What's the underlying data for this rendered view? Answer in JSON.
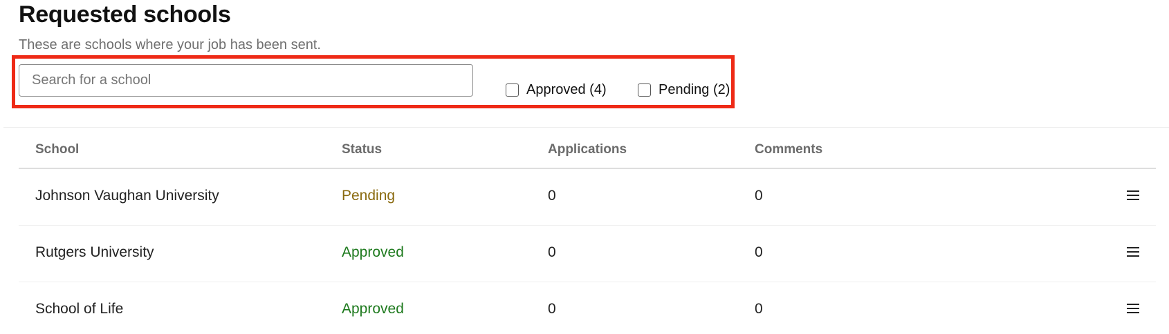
{
  "header": {
    "title": "Requested schools",
    "subtitle": "These are schools where your job has been sent."
  },
  "search": {
    "placeholder": "Search for a school",
    "value": ""
  },
  "filters": [
    {
      "label": "Approved (4)",
      "checked": false
    },
    {
      "label": "Pending (2)",
      "checked": false
    }
  ],
  "table": {
    "columns": [
      "School",
      "Status",
      "Applications",
      "Comments"
    ],
    "rows": [
      {
        "school": "Johnson Vaughan University",
        "status": "Pending",
        "applications": "0",
        "comments": "0"
      },
      {
        "school": "Rutgers University",
        "status": "Approved",
        "applications": "0",
        "comments": "0"
      },
      {
        "school": "School of Life",
        "status": "Approved",
        "applications": "0",
        "comments": "0"
      }
    ]
  },
  "icons": {
    "row_menu": "menu-icon"
  },
  "colors": {
    "highlight": "#ee2a16",
    "status_pending": "#8a6a0f",
    "status_approved": "#1e7a1e"
  }
}
